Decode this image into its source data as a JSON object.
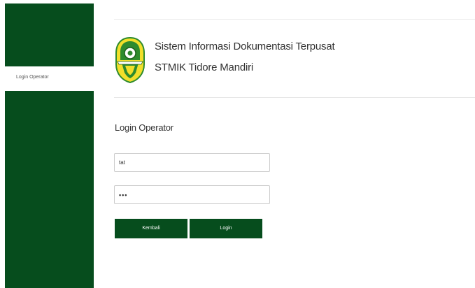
{
  "sidebar": {
    "items": [
      {
        "label": "Login Operator"
      }
    ]
  },
  "header": {
    "title_line1": "Sistem Informasi Dokumentasi Terpusat",
    "title_line2": "STMIK Tidore Mandiri",
    "logo_icon": "stmik-tidore-mandiri-logo"
  },
  "login": {
    "heading": "Login Operator",
    "username_value": "tat",
    "password_value": "•••",
    "back_label": "Kembali",
    "login_label": "Login"
  },
  "colors": {
    "brand_green": "#064d1d",
    "logo_yellow": "#f2df2a",
    "logo_green": "#2e8b2e"
  }
}
